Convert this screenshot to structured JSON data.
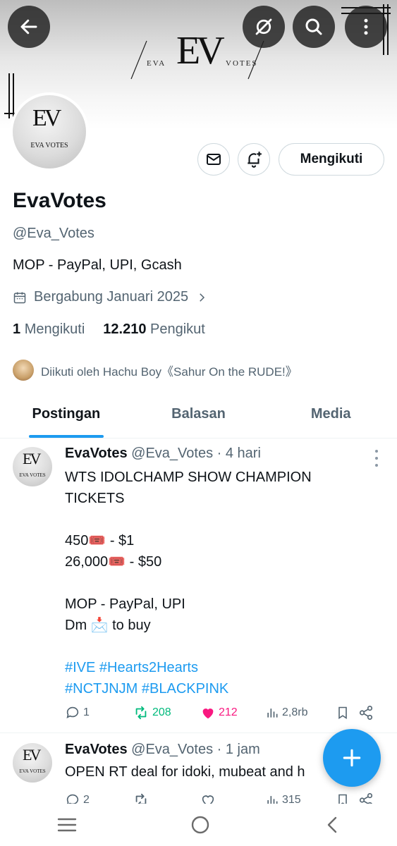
{
  "header": {
    "back_icon": "arrow-left-icon",
    "grok_icon": "grok-icon",
    "search_icon": "search-icon",
    "more_icon": "more-vertical-icon",
    "banner_logo": {
      "monogram": "EV",
      "left_word": "EVA",
      "right_word": "VOTES"
    }
  },
  "profile": {
    "avatar_monogram": "EV",
    "avatar_caption": "EVA VOTES",
    "message_icon": "mail-icon",
    "notify_icon": "bell-plus-icon",
    "follow_label": "Mengikuti",
    "display_name": "EvaVotes",
    "handle": "@Eva_Votes",
    "bio": "MOP - PayPal, UPI, Gcash",
    "joined": "Bergabung Januari 2025",
    "following_count": "1",
    "following_label": "Mengikuti",
    "followers_count": "12.210",
    "followers_label": "Pengikut",
    "followed_by": "Diikuti oleh Hachu Boy《Sahur On the RUDE!》"
  },
  "tabs": [
    {
      "label": "Postingan",
      "active": true
    },
    {
      "label": "Balasan",
      "active": false
    },
    {
      "label": "Media",
      "active": false
    }
  ],
  "posts": [
    {
      "name": "EvaVotes",
      "handle": "@Eva_Votes",
      "time": "· 4 hari",
      "lines": [
        "WTS IDOLCHAMP SHOW CHAMPION",
        "TICKETS",
        "",
        "450🎟️ - $1",
        "26,000🎟️ - $50",
        "",
        "MOP - PayPal, UPI",
        "Dm 📩 to buy",
        ""
      ],
      "hashtags": [
        "#IVE #Hearts2Hearts",
        "#NCTJNJM #BLACKPINK"
      ],
      "replies": "1",
      "reposts": "208",
      "likes": "212",
      "views": "2,8rb"
    },
    {
      "name": "EvaVotes",
      "handle": "@Eva_Votes",
      "time": "· 1 jam",
      "lines": [
        "OPEN RT deal for idoki, mubeat and h"
      ],
      "hashtags": [],
      "replies": "2",
      "reposts": "",
      "likes": "",
      "views": "315"
    }
  ],
  "fab_icon": "plus-icon",
  "system_nav": [
    "recent-apps-icon",
    "home-icon",
    "back-icon"
  ],
  "colors": {
    "accent": "#1d9bf0",
    "repost": "#00ba7c",
    "like": "#f91880",
    "muted": "#536471"
  }
}
